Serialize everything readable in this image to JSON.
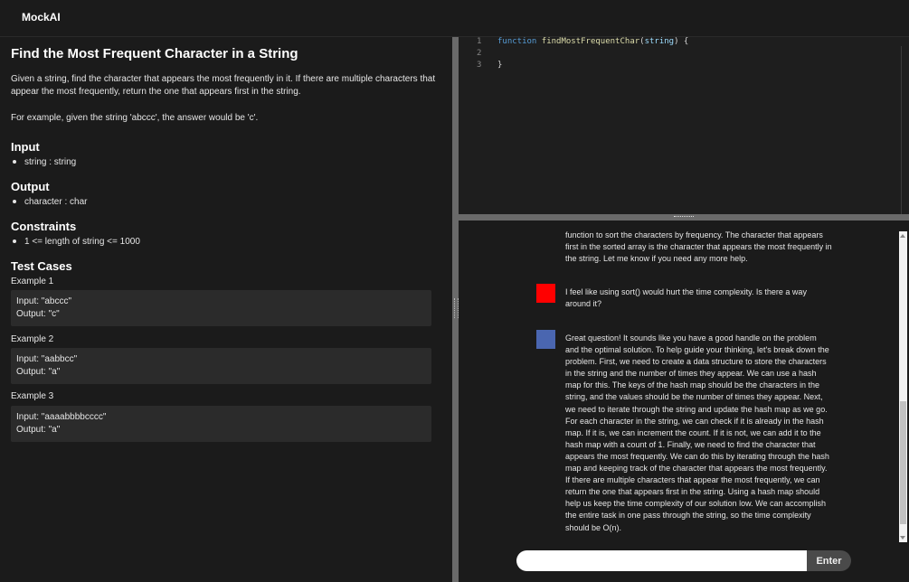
{
  "app": {
    "title": "MockAI"
  },
  "problem": {
    "title": "Find the Most Frequent Character in a String",
    "description": "Given a string, find the character that appears the most frequently in it. If there are multiple characters that appear the most frequently, return the one that appears first in the string.",
    "example": "For example, given the string 'abccc', the answer would be 'c'.",
    "input_heading": "Input",
    "input_items": [
      "string : string"
    ],
    "output_heading": "Output",
    "output_items": [
      "character : char"
    ],
    "constraints_heading": "Constraints",
    "constraints_items": [
      "1 <= length of string <= 1000"
    ],
    "test_cases_heading": "Test Cases",
    "test_cases": [
      {
        "label": "Example 1",
        "input": "Input: \"abccc\"",
        "output": "Output: \"c\""
      },
      {
        "label": "Example 2",
        "input": "Input: \"aabbcc\"",
        "output": "Output: \"a\""
      },
      {
        "label": "Example 3",
        "input": "Input: \"aaaabbbbcccc\"",
        "output": "Output: \"a\""
      }
    ]
  },
  "editor": {
    "lines": [
      {
        "num": "1",
        "keyword": "function",
        "fname": "findMostFrequentChar",
        "open": "(",
        "param": "string",
        "close": ") {"
      },
      {
        "num": "2",
        "text": ""
      },
      {
        "num": "3",
        "text": "}"
      }
    ]
  },
  "chat": {
    "messages": [
      {
        "role": "ai",
        "text": "function to sort the characters by frequency. The character that appears first in the sorted array is the character that appears the most frequently in the string. Let me know if you need any more help."
      },
      {
        "role": "user",
        "text": "I feel like using sort() would hurt the time complexity. Is there a way around it?"
      },
      {
        "role": "ai",
        "text": "Great question! It sounds like you have a good handle on the problem and the optimal solution. To help guide your thinking, let's break down the problem. First, we need to create a data structure to store the characters in the string and the number of times they appear. We can use a hash map for this. The keys of the hash map should be the characters in the string, and the values should be the number of times they appear. Next, we need to iterate through the string and update the hash map as we go. For each character in the string, we can check if it is already in the hash map. If it is, we can increment the count. If it is not, we can add it to the hash map with a count of 1. Finally, we need to find the character that appears the most frequently. We can do this by iterating through the hash map and keeping track of the character that appears the most frequently. If there are multiple characters that appear the most frequently, we can return the one that appears first in the string. Using a hash map should help us keep the time complexity of our solution low. We can accomplish the entire task in one pass through the string, so the time complexity should be O(n)."
      }
    ],
    "input_value": "",
    "enter_label": "Enter"
  },
  "colors": {
    "user_avatar": "#ff0000",
    "ai_avatar": "#4a66b0"
  }
}
